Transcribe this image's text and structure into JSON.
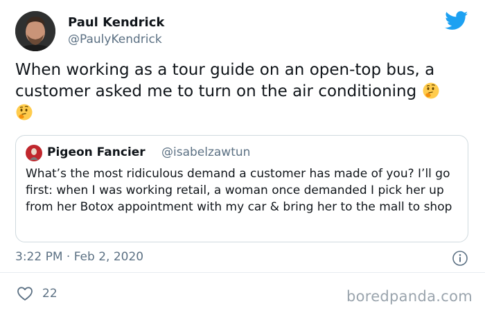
{
  "author": {
    "name": "Paul Kendrick",
    "handle": "@PaulyKendrick",
    "avatar_icon": "profile-photo"
  },
  "tweet": {
    "text": "When working as a tour guide on an open-top bus, a customer asked me to turn on the air conditioning",
    "emojis": [
      "thinking-face-emoji",
      "thinking-face-emoji"
    ]
  },
  "quoted_tweet": {
    "name": "Pigeon Fancier",
    "handle": "@isabelzawtun",
    "avatar_icon": "profile-photo",
    "text": "What’s the most ridiculous demand a customer has made of you? I’ll go first: when I was working retail, a woman once demanded I pick her up from her Botox appointment with my car & bring her to the mall to shop"
  },
  "meta": {
    "timestamp": "3:22 PM · Feb 2, 2020",
    "likes": "22"
  },
  "icons": {
    "platform": "twitter-bird-icon",
    "info": "info-icon",
    "like": "heart-icon"
  },
  "watermark": "boredpanda.com",
  "colors": {
    "twitter_blue": "#1da1f2",
    "text": "#0f1419",
    "secondary_text": "#5b7083",
    "border": "#cfd9de"
  }
}
